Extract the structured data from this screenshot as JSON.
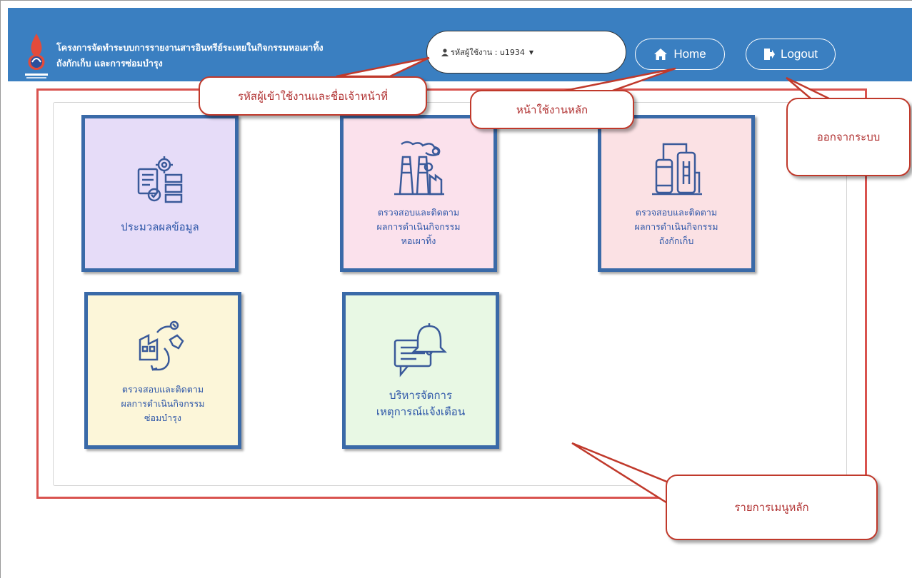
{
  "header": {
    "brand_line1": "โครงการจัดทำระบบการรายงานสารอินทรีย์ระเหยในกิจกรรมหอเผาทิ้ง",
    "brand_line2": "ถังกักเก็บ และการซ่อมบำรุง",
    "user_label": "รหัสผู้ใช้งาน : u1934",
    "home_label": "Home",
    "logout_label": "Logout"
  },
  "tiles": [
    {
      "label": "ประมวลผลข้อมูล",
      "bg": "#e6dcf8",
      "icon": "data-processing-icon"
    },
    {
      "label": "ตรวจสอบและติดตาม\nผลการดำเนินกิจกรรม\nหอเผาทิ้ง",
      "bg": "#fbe1ec",
      "icon": "flare-factory-icon"
    },
    {
      "label": "ตรวจสอบและติดตาม\nผลการดำเนินกิจกรรม\nถังกักเก็บ",
      "bg": "#fbe1e4",
      "icon": "storage-tank-icon"
    },
    {
      "label": "ตรวจสอบและติดตาม\nผลการดำเนินกิจกรรม\nซ่อมบำรุง",
      "bg": "#fcf6d9",
      "icon": "maintenance-icon"
    },
    {
      "label": "บริหารจัดการ\nเหตุการณ์แจ้งเตือน",
      "bg": "#e8f8e4",
      "icon": "notification-icon"
    }
  ],
  "callouts": {
    "user_info": "รหัสผู้เข้าใช้งานและชื่อเจ้าหน้าที่",
    "home_page": "หน้าใช้งานหลัก",
    "logout": "ออกจากระบบ",
    "main_menu": "รายการเมนูหลัก"
  },
  "colors": {
    "header_bg": "#3a7fc1",
    "tile_border": "#3a6aa8",
    "tile_text": "#2d56a8",
    "annotation_red": "#c0392b"
  }
}
